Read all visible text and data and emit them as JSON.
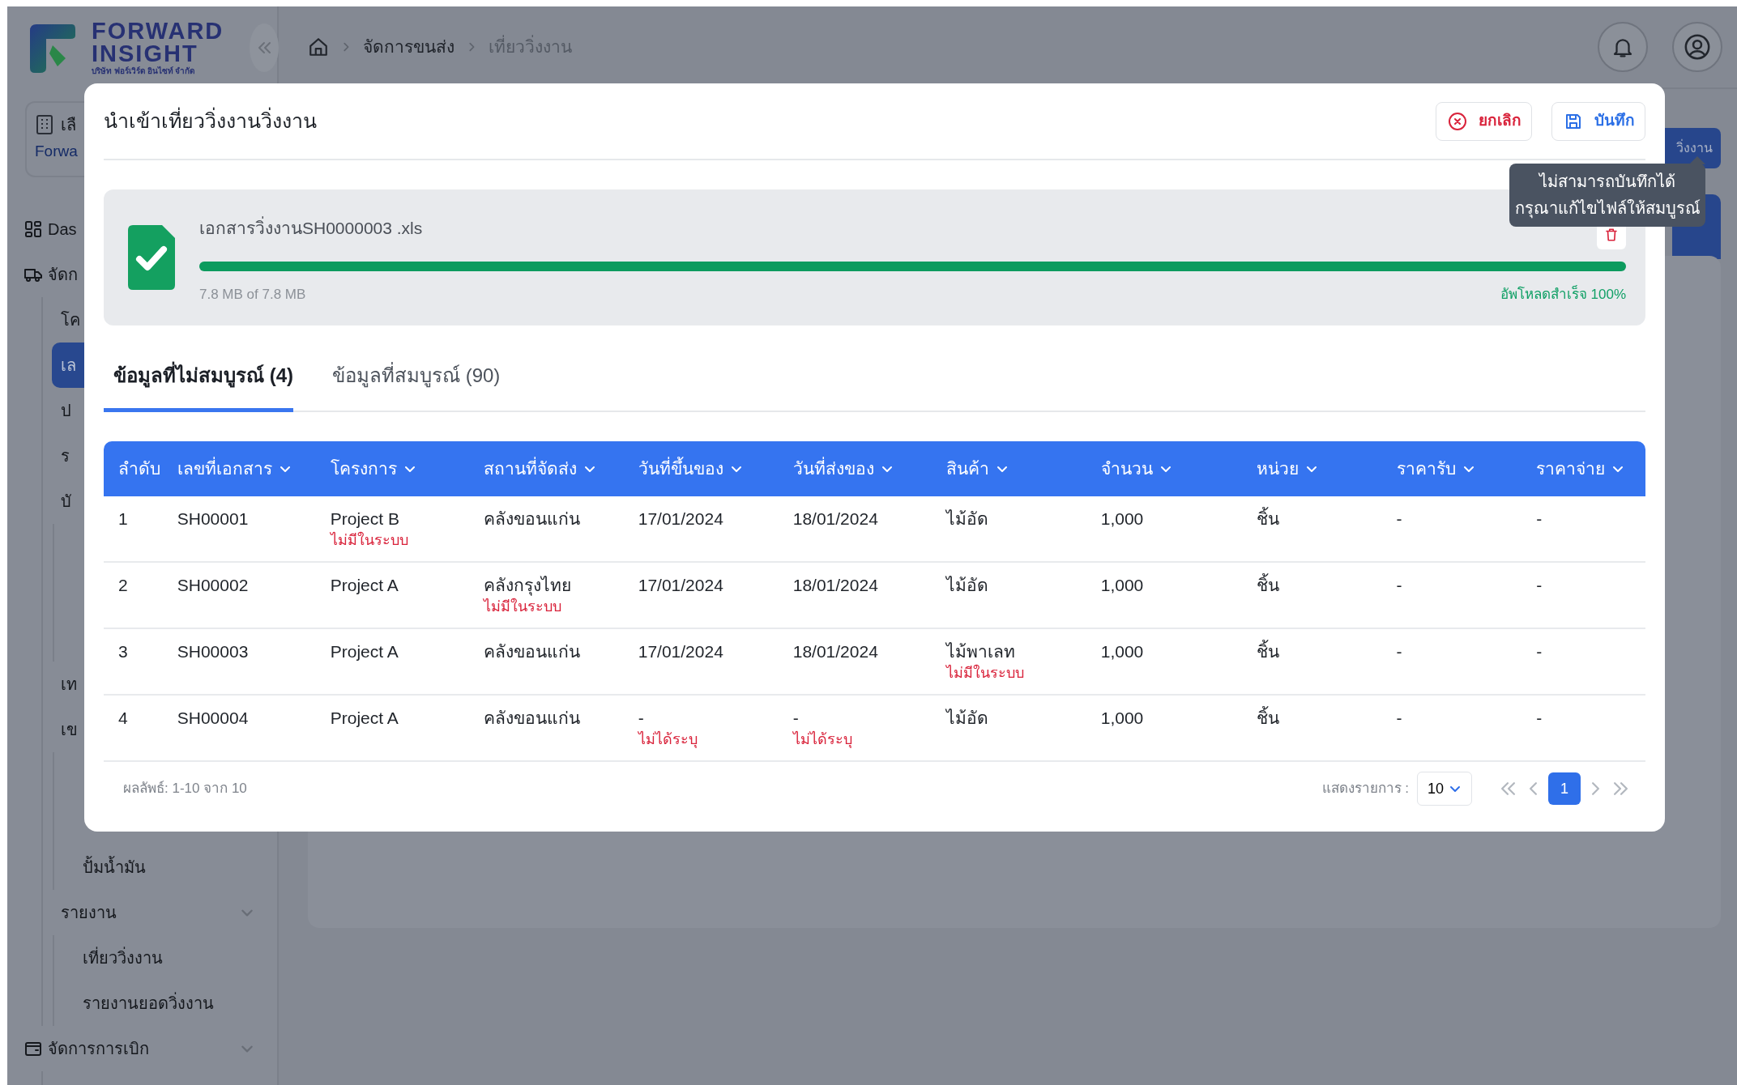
{
  "sidebar": {
    "logo": {
      "line1": "FORWARD",
      "line2": "INSIGHT",
      "tagline": "บริษัท ฟอร์เวิร์ด อินไซท์ จำกัด"
    },
    "company_select": {
      "label": "เลื",
      "value": "Forwa"
    },
    "menu": [
      {
        "label": "Das",
        "selected": false
      },
      {
        "label": "จัดก",
        "selected": false,
        "expanded": true,
        "children": [
          {
            "label": "โค",
            "selected": false
          },
          {
            "label": "เล",
            "selected": true
          },
          {
            "label": "ป",
            "selected": false
          },
          {
            "label": "ร",
            "selected": false
          },
          {
            "label": "บั",
            "selected": false,
            "expanded": true
          },
          {
            "label": "เท",
            "selected": false
          },
          {
            "label": "เข",
            "selected": false,
            "expanded": true,
            "children": [
              {
                "label": "ปั้มน้ำมัน",
                "selected": false
              }
            ]
          },
          {
            "kind": "group",
            "label": "รายงาน",
            "selected": false,
            "expanded": true,
            "children": [
              {
                "label": "เที่ยววิ่งงาน",
                "selected": false
              },
              {
                "label": "รายงานยอดวิ่งงาน",
                "selected": false
              }
            ]
          }
        ]
      },
      {
        "kind": "group",
        "label": "จัดการการเบิก",
        "selected": false,
        "expanded": true
      }
    ]
  },
  "breadcrumb": [
    {
      "label": "จัดการขนส่ง",
      "current": false
    },
    {
      "label": "เที่ยววิ่งงาน",
      "current": true
    }
  ],
  "page_button": {
    "label": "วิ่งงาน"
  },
  "modal": {
    "title": "นำเข้าเที่ยววิ่งงานวิ่งงาน",
    "buttons": [
      {
        "kind": "cancel",
        "label": "ยกเลิก"
      },
      {
        "kind": "save",
        "label": "บันทึก"
      }
    ],
    "tooltip": {
      "lines": [
        "ไม่สามารถบันทึกได้",
        "กรุณาแก้ไขไฟล์ให้สมบูรณ์"
      ]
    },
    "upload": {
      "file_name": "เอกสารวิ่งงานSH0000003 .xls",
      "level": 1.0,
      "size": "7.8 MB of 7.8 MB",
      "status": "อัพโหลดสำเร็จ 100%"
    },
    "tabs": [
      {
        "label": "ข้อมูลที่ไม่สมบูรณ์ (4)",
        "selected": true
      },
      {
        "label": "ข้อมูลที่สมบูรณ์ (90)",
        "selected": false
      }
    ],
    "table": {
      "columns": [
        {
          "label": "ลำดับ",
          "sortable": false
        },
        {
          "label": "เลขที่เอกสาร",
          "sortable": true
        },
        {
          "label": "โครงการ",
          "sortable": true
        },
        {
          "label": "สถานที่จัดส่ง",
          "sortable": true
        },
        {
          "label": "วันที่ขึ้นของ",
          "sortable": true
        },
        {
          "label": "วันที่ส่งของ",
          "sortable": true
        },
        {
          "label": "สินค้า",
          "sortable": true
        },
        {
          "label": "จำนวน",
          "sortable": true
        },
        {
          "label": "หน่วย",
          "sortable": true
        },
        {
          "label": "ราคารับ",
          "sortable": true
        },
        {
          "label": "ราคาจ่าย",
          "sortable": true
        }
      ],
      "rows": [
        {
          "cells": [
            {
              "text": "1"
            },
            {
              "text": "SH00001"
            },
            {
              "text": "Project B",
              "error": "ไม่มีในระบบ"
            },
            {
              "text": "คลังขอนแก่น"
            },
            {
              "text": "17/01/2024"
            },
            {
              "text": "18/01/2024"
            },
            {
              "text": "ไม้อัด"
            },
            {
              "text": "1,000"
            },
            {
              "text": "ชิ้น"
            },
            {
              "text": "-"
            },
            {
              "text": "-"
            }
          ]
        },
        {
          "cells": [
            {
              "text": "2"
            },
            {
              "text": "SH00002"
            },
            {
              "text": "Project A"
            },
            {
              "text": "คลังกรุงไทย",
              "error": "ไม่มีในระบบ"
            },
            {
              "text": "17/01/2024"
            },
            {
              "text": "18/01/2024"
            },
            {
              "text": "ไม้อัด"
            },
            {
              "text": "1,000"
            },
            {
              "text": "ชิ้น"
            },
            {
              "text": "-"
            },
            {
              "text": "-"
            }
          ]
        },
        {
          "cells": [
            {
              "text": "3"
            },
            {
              "text": "SH00003"
            },
            {
              "text": "Project A"
            },
            {
              "text": "คลังขอนแก่น"
            },
            {
              "text": "17/01/2024"
            },
            {
              "text": "18/01/2024"
            },
            {
              "text": "ไม้พาเลท",
              "error": "ไม่มีในระบบ"
            },
            {
              "text": "1,000"
            },
            {
              "text": "ชิ้น"
            },
            {
              "text": "-"
            },
            {
              "text": "-"
            }
          ]
        },
        {
          "cells": [
            {
              "text": "4"
            },
            {
              "text": "SH00004"
            },
            {
              "text": "Project A"
            },
            {
              "text": "คลังขอนแก่น"
            },
            {
              "text": "-",
              "error": "ไม่ได้ระบุ"
            },
            {
              "text": "-",
              "error": "ไม่ได้ระบุ"
            },
            {
              "text": "ไม้อัด"
            },
            {
              "text": "1,000"
            },
            {
              "text": "ชิ้น"
            },
            {
              "text": "-"
            },
            {
              "text": "-"
            }
          ]
        }
      ]
    },
    "footer": {
      "result": "ผลลัพธ์: 1-10 จาก 10",
      "page_size_label": "แสดงรายการ :",
      "page_size": "10",
      "pages": [
        {
          "label": "1",
          "selected": true
        }
      ]
    }
  }
}
